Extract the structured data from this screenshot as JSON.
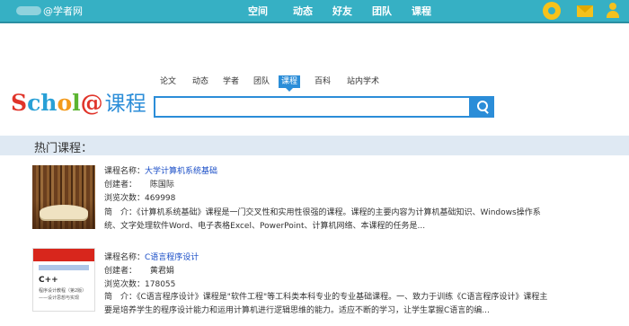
{
  "brand": {
    "suffix": "@学者网"
  },
  "topnav": [
    "空间",
    "动态",
    "好友",
    "团队",
    "课程"
  ],
  "topicons": [
    "gear-icon",
    "mail-icon",
    "user-icon"
  ],
  "logo": {
    "s": "S",
    "ch": "ch",
    "o": "o",
    "l": "l",
    "at": "@",
    "kc": "课程"
  },
  "search": {
    "tabs": [
      "论文",
      "动态",
      "学者",
      "团队",
      "课程",
      "百科",
      "站内学术"
    ],
    "active_tab": "课程",
    "value": "",
    "placeholder": ""
  },
  "hot": {
    "title": "热门课程："
  },
  "courses": [
    {
      "name_label": "课程名称：",
      "name": "大学计算机系统基础",
      "creator_label": "创建者：",
      "creator": "陈国际",
      "views_label": "浏览次数：",
      "views": "469998",
      "desc_label": "简　介：",
      "desc": "《计算机系统基础》课程是一门交叉性和实用性很强的课程。课程的主要内容为计算机基础知识、Windows操作系统、文字处理软件Word、电子表格Excel、PowerPoint、计算机网络、本课程的任务是..."
    },
    {
      "name_label": "课程名称：",
      "name": "C语言程序设计",
      "creator_label": "创建者：",
      "creator": "黄君娟",
      "views_label": "浏览次数：",
      "views": "178055",
      "desc_label": "简　介：",
      "desc": "《C语言程序设计》课程是\"软件工程\"等工科类本科专业的专业基础课程。一、致力于训练《C语言程序设计》课程主要是培养学生的程序设计能力和运用计算机进行逻辑思维的能力。适应不断的学习，让学生掌握C语言的编..."
    }
  ],
  "book_cover": {
    "title": "C++",
    "subtitle": "程序设计教程（第2版）",
    "sub2": "——设计思想与实现"
  },
  "colors": {
    "topbar": "#36b0c4",
    "accent": "#2b8dd8",
    "link": "#1a4ec7",
    "hotbar": "#dfe9f3"
  }
}
